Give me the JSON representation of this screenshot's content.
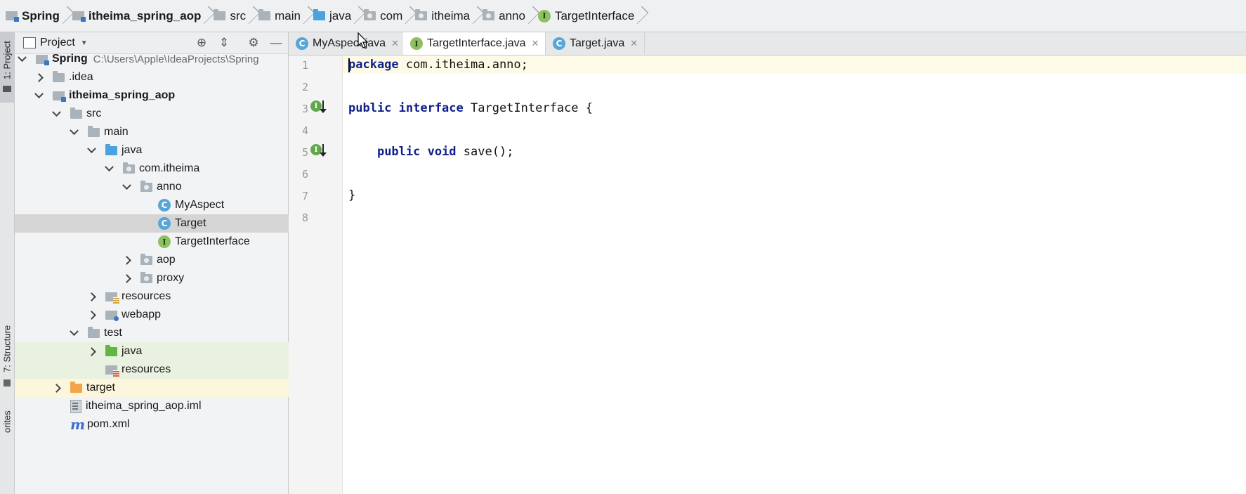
{
  "breadcrumb": [
    {
      "label": "Spring",
      "icon": "module-folder-icon",
      "bold": true
    },
    {
      "label": "itheima_spring_aop",
      "icon": "module-folder-icon",
      "bold": true
    },
    {
      "label": "src",
      "icon": "folder-icon"
    },
    {
      "label": "main",
      "icon": "folder-icon"
    },
    {
      "label": "java",
      "icon": "source-folder-icon"
    },
    {
      "label": "com",
      "icon": "package-icon"
    },
    {
      "label": "itheima",
      "icon": "package-icon"
    },
    {
      "label": "anno",
      "icon": "package-icon"
    },
    {
      "label": "TargetInterface",
      "icon": "interface-icon"
    }
  ],
  "side_tools": {
    "project": "1: Project",
    "structure": "7: Structure",
    "favorites": "orites"
  },
  "project_panel": {
    "title": "Project",
    "tree": [
      {
        "label": "Spring",
        "path": "C:\\Users\\Apple\\IdeaProjects\\Spring"
      },
      {
        "label": ".idea"
      },
      {
        "label": "itheima_spring_aop"
      },
      {
        "label": "src"
      },
      {
        "label": "main"
      },
      {
        "label": "java"
      },
      {
        "label": "com.itheima"
      },
      {
        "label": "anno"
      },
      {
        "label": "MyAspect"
      },
      {
        "label": "Target"
      },
      {
        "label": "TargetInterface"
      },
      {
        "label": "aop"
      },
      {
        "label": "proxy"
      },
      {
        "label": "resources"
      },
      {
        "label": "webapp"
      },
      {
        "label": "test"
      },
      {
        "label": "java"
      },
      {
        "label": "resources"
      },
      {
        "label": "target"
      },
      {
        "label": "itheima_spring_aop.iml"
      },
      {
        "label": "pom.xml"
      }
    ]
  },
  "tabs": [
    {
      "label": "MyAspect.java",
      "icon": "class-icon",
      "active": false
    },
    {
      "label": "TargetInterface.java",
      "icon": "interface-icon",
      "active": true
    },
    {
      "label": "Target.java",
      "icon": "class-icon",
      "active": false
    }
  ],
  "editor": {
    "line_numbers": [
      "1",
      "2",
      "3",
      "4",
      "5",
      "6",
      "7",
      "8"
    ],
    "lines": [
      {
        "kw": "package",
        "rest": " com.itheima.anno;"
      },
      {
        "kw": "",
        "rest": ""
      },
      {
        "kw": "public interface",
        "rest": " TargetInterface {"
      },
      {
        "kw": "",
        "rest": ""
      },
      {
        "kw": "public void",
        "rest": " save();",
        "indent": "    "
      },
      {
        "kw": "",
        "rest": ""
      },
      {
        "kw": "",
        "rest": "}"
      },
      {
        "kw": "",
        "rest": ""
      }
    ]
  },
  "colors": {
    "keyword": "#0f1f8a",
    "current_line": "#fdfbe7",
    "selection": "#d5d5d5"
  }
}
